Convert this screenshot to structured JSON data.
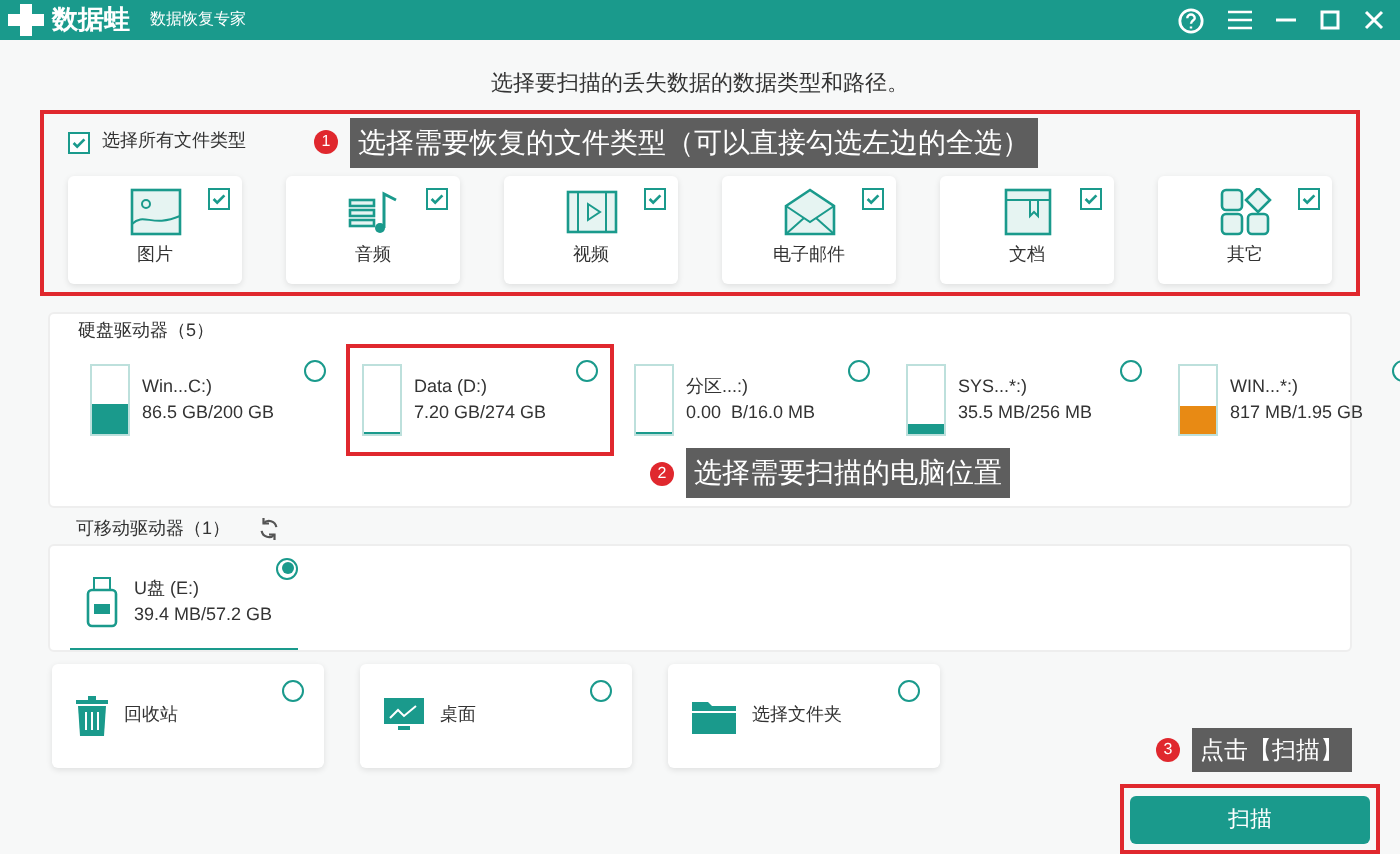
{
  "window": {
    "app_name": "数据蛙",
    "subtitle": "数据恢复专家"
  },
  "heading": "选择要扫描的丢失数据的数据类型和路径。",
  "file_types": {
    "select_all": {
      "label": "选择所有文件类型",
      "checked": true
    },
    "items": [
      {
        "label": "图片",
        "kind": "image",
        "checked": true
      },
      {
        "label": "音频",
        "kind": "audio",
        "checked": true
      },
      {
        "label": "视频",
        "kind": "video",
        "checked": true
      },
      {
        "label": "电子邮件",
        "kind": "email",
        "checked": true
      },
      {
        "label": "文档",
        "kind": "document",
        "checked": true
      },
      {
        "label": "其它",
        "kind": "other",
        "checked": true
      }
    ]
  },
  "hard_drives": {
    "title": "硬盘驱动器（5）",
    "items": [
      {
        "name": "Win...C:)",
        "size": "86.5 GB/200 GB",
        "level": 0.43,
        "color": "#1a9a8c",
        "selected": false
      },
      {
        "name": "Data (D:)",
        "size": "7.20 GB/274 GB",
        "level": 0.03,
        "color": "#1a9a8c",
        "selected": false
      },
      {
        "name": "分区...:)",
        "size": "0.00  B/16.0 MB",
        "level": 0,
        "color": "#1a9a8c",
        "selected": false
      },
      {
        "name": "SYS...*:)",
        "size": "35.5 MB/256 MB",
        "level": 0.14,
        "color": "#1a9a8c",
        "selected": false
      },
      {
        "name": "WIN...*:)",
        "size": "817 MB/1.95 GB",
        "level": 0.41,
        "color": "#e88a14",
        "selected": false
      }
    ]
  },
  "removable_drives": {
    "title": "可移动驱动器（1）",
    "items": [
      {
        "name": "U盘 (E:)",
        "size": "39.4 MB/57.2 GB",
        "selected": true
      }
    ]
  },
  "locations": [
    {
      "label": "回收站",
      "kind": "trash",
      "selected": false
    },
    {
      "label": "桌面",
      "kind": "desktop",
      "selected": false
    },
    {
      "label": "选择文件夹",
      "kind": "folder",
      "selected": false
    }
  ],
  "scan_button": "扫描",
  "annotations": [
    {
      "number": "1",
      "text": "选择需要恢复的文件类型（可以直接勾选左边的全选）"
    },
    {
      "number": "2",
      "text": "选择需要扫描的电脑位置"
    },
    {
      "number": "3",
      "text": "点击【扫描】"
    }
  ]
}
